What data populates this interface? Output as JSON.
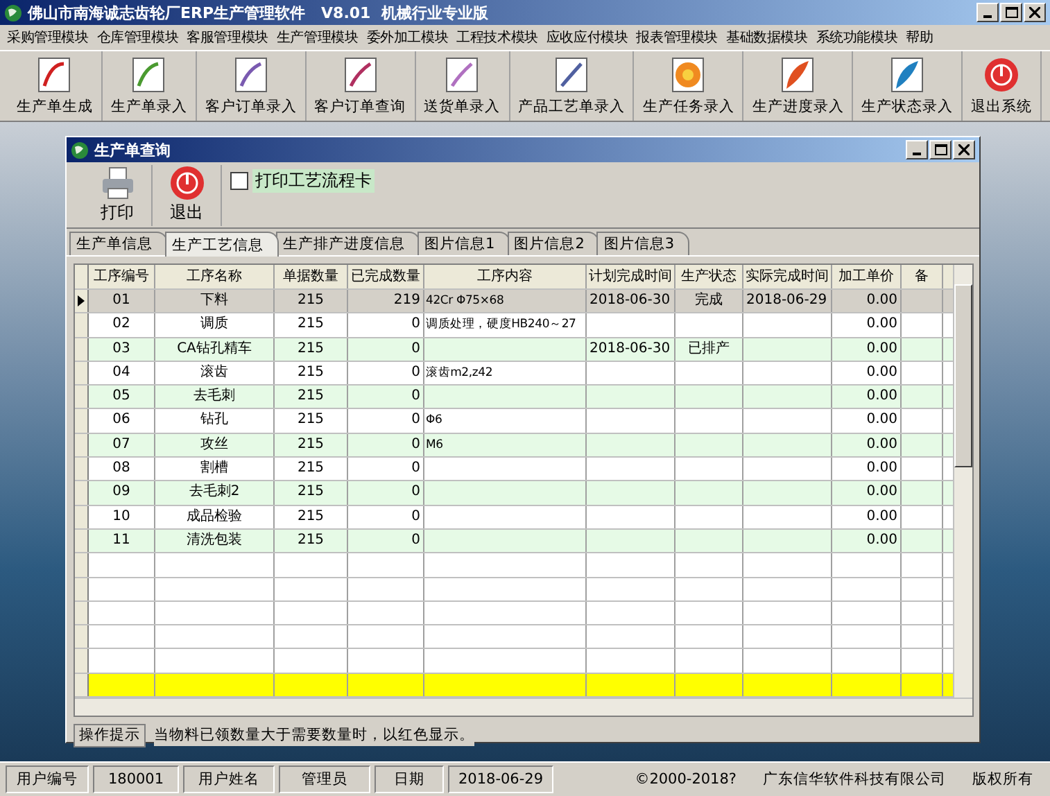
{
  "window": {
    "title": "佛山市南海诚志齿轮厂ERP生产管理软件   V8.01  机械行业专业版"
  },
  "menu": [
    "采购管理模块",
    "仓库管理模块",
    "客服管理模块",
    "生产管理模块",
    "委外加工模块",
    "工程技术模块",
    "应收应付模块",
    "报表管理模块",
    "基础数据模块",
    "系统功能模块",
    "帮助"
  ],
  "toolbar": [
    {
      "label": "生产单生成",
      "kind": "document"
    },
    {
      "label": "生产单录入",
      "kind": "document"
    },
    {
      "label": "客户订单录入",
      "kind": "document"
    },
    {
      "label": "客户订单查询",
      "kind": "document"
    },
    {
      "label": "送货单录入",
      "kind": "document"
    },
    {
      "label": "产品工艺单录入",
      "kind": "document"
    },
    {
      "label": "生产任务录入",
      "kind": "flower"
    },
    {
      "label": "生产进度录入",
      "kind": "feather"
    },
    {
      "label": "生产状态录入",
      "kind": "feather"
    },
    {
      "label": "退出系统",
      "kind": "power"
    }
  ],
  "child_window": {
    "title": "生产单查询",
    "toolbar": [
      {
        "label": "打印",
        "kind": "printer"
      },
      {
        "label": "退出",
        "kind": "power"
      }
    ],
    "print_card": {
      "label": "打印工艺流程卡",
      "checked": false
    },
    "tabs": [
      {
        "label": "生产单信息",
        "selected": false
      },
      {
        "label": "生产工艺信息",
        "selected": true
      },
      {
        "label": "生产排产进度信息",
        "selected": false
      },
      {
        "label": "图片信息1",
        "selected": false
      },
      {
        "label": "图片信息2",
        "selected": false
      },
      {
        "label": "图片信息3",
        "selected": false
      }
    ],
    "table": {
      "columns": [
        "工序编号",
        "工序名称",
        "单据数量",
        "已完成数量",
        "工序内容",
        "计划完成时间",
        "生产状态",
        "实际完成时间",
        "加工单价",
        "备"
      ],
      "rows": [
        {
          "selected": true,
          "cells": [
            "01",
            "下料",
            "215",
            "219",
            "42Cr Φ75×68",
            "2018-06-30",
            "完成",
            "2018-06-29",
            "0.00",
            ""
          ]
        },
        {
          "selected": false,
          "cells": [
            "02",
            "调质",
            "215",
            "0",
            "调质处理，硬度HB240～27",
            "",
            "",
            "",
            "0.00",
            ""
          ]
        },
        {
          "selected": false,
          "cells": [
            "03",
            "CA钻孔精车",
            "215",
            "0",
            "",
            "2018-06-30",
            "已排产",
            "",
            "0.00",
            ""
          ]
        },
        {
          "selected": false,
          "cells": [
            "04",
            "滚齿",
            "215",
            "0",
            "滚齿m2,z42",
            "",
            "",
            "",
            "0.00",
            ""
          ]
        },
        {
          "selected": false,
          "cells": [
            "05",
            "去毛刺",
            "215",
            "0",
            "",
            "",
            "",
            "",
            "0.00",
            ""
          ]
        },
        {
          "selected": false,
          "cells": [
            "06",
            "钻孔",
            "215",
            "0",
            "Φ6",
            "",
            "",
            "",
            "0.00",
            ""
          ]
        },
        {
          "selected": false,
          "cells": [
            "07",
            "攻丝",
            "215",
            "0",
            "M6",
            "",
            "",
            "",
            "0.00",
            ""
          ]
        },
        {
          "selected": false,
          "cells": [
            "08",
            "割槽",
            "215",
            "0",
            "",
            "",
            "",
            "",
            "0.00",
            ""
          ]
        },
        {
          "selected": false,
          "cells": [
            "09",
            "去毛刺2",
            "215",
            "0",
            "",
            "",
            "",
            "",
            "0.00",
            ""
          ]
        },
        {
          "selected": false,
          "cells": [
            "10",
            "成品检验",
            "215",
            "0",
            "",
            "",
            "",
            "",
            "0.00",
            ""
          ]
        },
        {
          "selected": false,
          "cells": [
            "11",
            "清洗包装",
            "215",
            "0",
            "",
            "",
            "",
            "",
            "0.00",
            ""
          ]
        }
      ]
    },
    "hint": {
      "label": "操作提示",
      "text": "当物料已领数量大于需要数量时，以红色显示。"
    }
  },
  "status_bar": [
    "用户编号",
    "180001",
    "用户姓名",
    "管理员",
    "日期",
    "2018-06-29",
    "©2000-2018?",
    "广东信华软件科技有限公司",
    "版权所有"
  ]
}
